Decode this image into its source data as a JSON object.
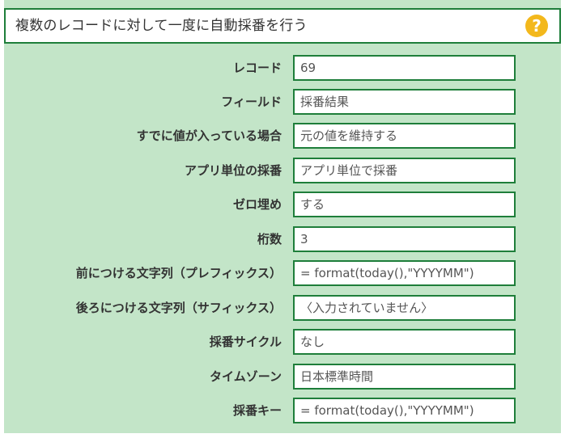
{
  "header": {
    "title": "複数のレコードに対して一度に自動採番を行う",
    "help_symbol": "?",
    "help_color": "#f3b81c"
  },
  "colors": {
    "panel_background": "#c3e5c8",
    "border": "#1e7e3a"
  },
  "rows": [
    {
      "label": "レコード",
      "value": "69"
    },
    {
      "label": "フィールド",
      "value": "採番結果"
    },
    {
      "label": "すでに値が入っている場合",
      "value": "元の値を維持する"
    },
    {
      "label": "アプリ単位の採番",
      "value": "アプリ単位で採番"
    },
    {
      "label": "ゼロ埋め",
      "value": "する"
    },
    {
      "label": "桁数",
      "value": "3"
    },
    {
      "label": "前につける文字列（プレフィックス）",
      "value": "= format(today(),\"YYYYMM\")"
    },
    {
      "label": "後ろにつける文字列（サフィックス）",
      "value": "〈入力されていません〉"
    },
    {
      "label": "採番サイクル",
      "value": "なし"
    },
    {
      "label": "タイムゾーン",
      "value": "日本標準時間"
    },
    {
      "label": "採番キー",
      "value": "= format(today(),\"YYYYMM\")"
    }
  ]
}
